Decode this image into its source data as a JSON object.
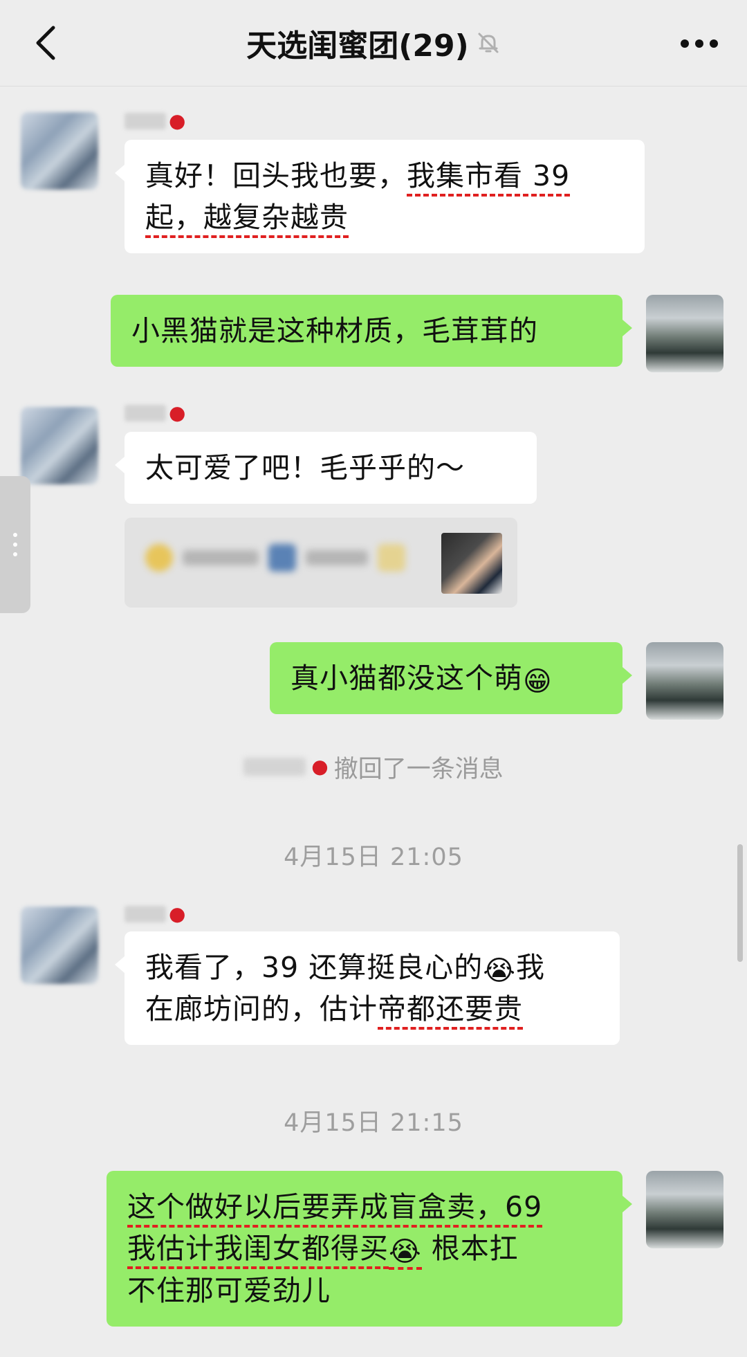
{
  "header": {
    "title": "天选闺蜜团(29)"
  },
  "messages": {
    "m1": {
      "part1": "真好！回头我也要，",
      "part2": "我集市看 39",
      "part3": "起，越复杂越贵"
    },
    "m2": {
      "text": "小黑猫就是这种材质，毛茸茸的"
    },
    "m3": {
      "text": "太可爱了吧！毛乎乎的～"
    },
    "m4": {
      "text": "真小猫都没这个萌",
      "emoji": "😁"
    },
    "recall": {
      "text": "撤回了一条消息"
    },
    "time1": "4月15日 21:05",
    "m5": {
      "part1": "我看了，39 还算挺良心的",
      "emoji": "😭",
      "part2": "我",
      "part3": "在廊坊问的，估计",
      "part4": "帝都还要贵"
    },
    "time2": "4月15日 21:15",
    "m6": {
      "part1": "这个做好以后要弄成盲盒卖，69",
      "part2": "我估计我闺女都得买",
      "emoji": "😭",
      "part3": " 根本扛",
      "part4": "不住那可爱劲儿"
    }
  },
  "icons": {
    "back": "chevron-left-icon",
    "mute": "bell-off-icon",
    "more": "more-dots-icon",
    "sender_tag": "cherry-icon"
  },
  "colors": {
    "self_bubble": "#95ec69",
    "other_bubble": "#ffffff",
    "background": "#ededed",
    "underline": "#e02020"
  }
}
